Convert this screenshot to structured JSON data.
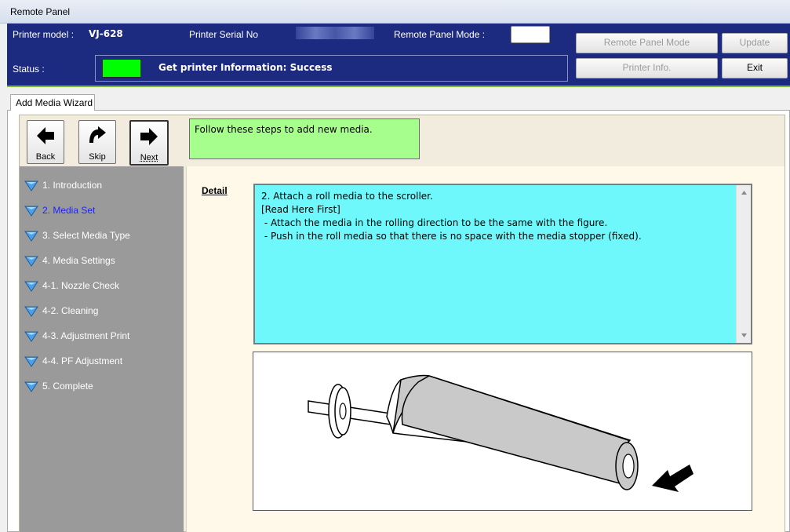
{
  "window": {
    "title": "Remote Panel"
  },
  "header": {
    "printer_model_label": "Printer model :",
    "printer_model_value": "VJ-628",
    "serial_label": "Printer Serial No",
    "mode_label": "Remote Panel Mode :",
    "status_label": "Status :",
    "status_text": "Get printer Information: Success",
    "status_led_color": "#00ff00"
  },
  "toolbar": {
    "remote_panel_mode": "Remote Panel Mode",
    "update": "Update",
    "printer_info": "Printer Info.",
    "exit": "Exit"
  },
  "tab": {
    "label": "Add Media Wizard"
  },
  "wizard": {
    "back": "Back",
    "skip": "Skip",
    "next": "Next",
    "instruction": "Follow these steps to add new media.",
    "steps": [
      {
        "label": "1. Introduction",
        "active": false
      },
      {
        "label": "2. Media Set",
        "active": true
      },
      {
        "label": "3. Select Media Type",
        "active": false
      },
      {
        "label": "4. Media Settings",
        "active": false
      },
      {
        "label": "4-1. Nozzle Check",
        "active": false
      },
      {
        "label": "4-2. Cleaning",
        "active": false
      },
      {
        "label": "4-3. Adjustment Print",
        "active": false
      },
      {
        "label": "4-4. PF Adjustment",
        "active": false
      },
      {
        "label": "5. Complete",
        "active": false
      }
    ],
    "detail_label": "Detail",
    "detail_lines": [
      "2. Attach a roll media to the scroller.",
      "",
      "[Read Here First]",
      " - Attach the media in the rolling direction to be the same with the figure.",
      " - Push in the roll media so that there is no space with the media stopper (fixed)."
    ]
  },
  "colors": {
    "header_bg": "#1c2b80",
    "accent_green": "#7db82f",
    "instruction_bg": "#a6ff8c",
    "detail_bg": "#6ff8fb",
    "active_step": "#1e22ff"
  }
}
